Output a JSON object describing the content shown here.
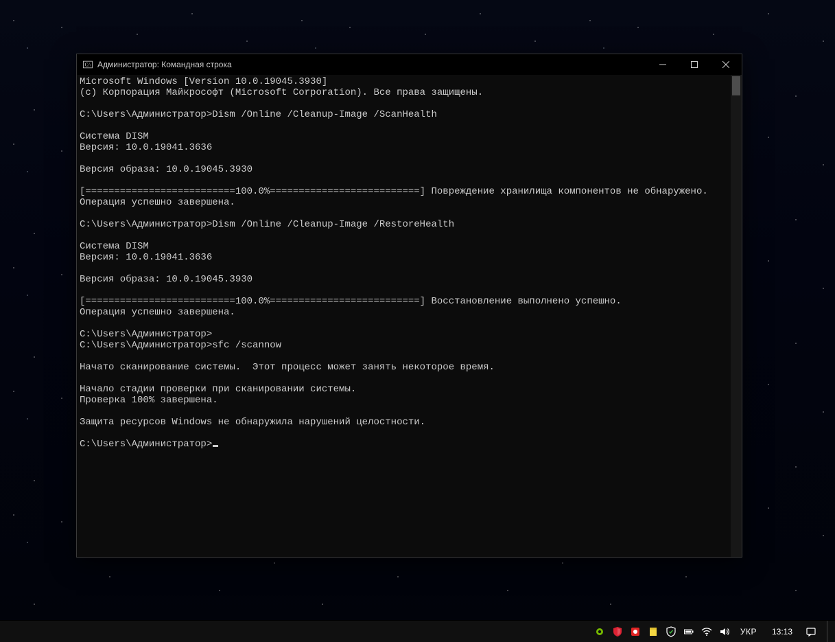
{
  "window": {
    "title": "Администратор: Командная строка"
  },
  "terminal": {
    "lines": [
      "Microsoft Windows [Version 10.0.19045.3930]",
      "(c) Корпорация Майкрософт (Microsoft Corporation). Все права защищены.",
      "",
      "C:\\Users\\Администратор>Dism /Online /Cleanup-Image /ScanHealth",
      "",
      "Cистема DISM",
      "Версия: 10.0.19041.3636",
      "",
      "Версия образа: 10.0.19045.3930",
      "",
      "[==========================100.0%==========================] Повреждение хранилища компонентов не обнаружено.",
      "Операция успешно завершена.",
      "",
      "C:\\Users\\Администратор>Dism /Online /Cleanup-Image /RestoreHealth",
      "",
      "Cистема DISM",
      "Версия: 10.0.19041.3636",
      "",
      "Версия образа: 10.0.19045.3930",
      "",
      "[==========================100.0%==========================] Восстановление выполнено успешно.",
      "Операция успешно завершена.",
      "",
      "C:\\Users\\Администратор>",
      "C:\\Users\\Администратор>sfc /scannow",
      "",
      "Начато сканирование системы.  Этот процесс может занять некоторое время.",
      "",
      "Начало стадии проверки при сканировании системы.",
      "Проверка 100% завершена.",
      "",
      "Защита ресурсов Windows не обнаружила нарушений целостности.",
      ""
    ],
    "prompt": "C:\\Users\\Администратор>"
  },
  "taskbar": {
    "language": "УКР",
    "clock": "13:13"
  }
}
